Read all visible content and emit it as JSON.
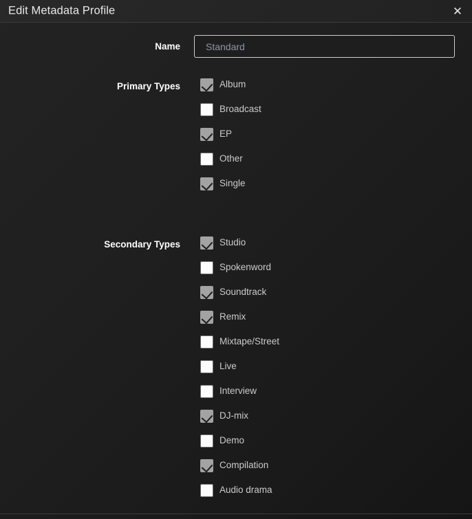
{
  "dialog": {
    "title": "Edit Metadata Profile",
    "close_icon": "close-icon",
    "close_glyph": "✕"
  },
  "name_field": {
    "label": "Name",
    "value": "Standard",
    "placeholder": "Standard"
  },
  "primary_types": {
    "label": "Primary Types",
    "items": [
      {
        "label": "Album",
        "checked": true
      },
      {
        "label": "Broadcast",
        "checked": false
      },
      {
        "label": "EP",
        "checked": true
      },
      {
        "label": "Other",
        "checked": false
      },
      {
        "label": "Single",
        "checked": true
      }
    ]
  },
  "secondary_types": {
    "label": "Secondary Types",
    "items": [
      {
        "label": "Studio",
        "checked": true
      },
      {
        "label": "Spokenword",
        "checked": false
      },
      {
        "label": "Soundtrack",
        "checked": true
      },
      {
        "label": "Remix",
        "checked": true
      },
      {
        "label": "Mixtape/Street",
        "checked": false
      },
      {
        "label": "Live",
        "checked": false
      },
      {
        "label": "Interview",
        "checked": false
      },
      {
        "label": "DJ-mix",
        "checked": true
      },
      {
        "label": "Demo",
        "checked": false
      },
      {
        "label": "Compilation",
        "checked": true
      },
      {
        "label": "Audio drama",
        "checked": false
      }
    ]
  },
  "colors": {
    "background_top": "#232323",
    "background_bottom": "#151515",
    "header_background": "#252525",
    "divider": "#3c3c3c",
    "label_text": "#ffffff",
    "item_text": "#cbcbcb",
    "checkbox_checked": "#a3a3a3",
    "checkbox_unchecked": "#fdfdfd",
    "input_border": "#cfcfcf",
    "input_text": "#8d96a3"
  }
}
